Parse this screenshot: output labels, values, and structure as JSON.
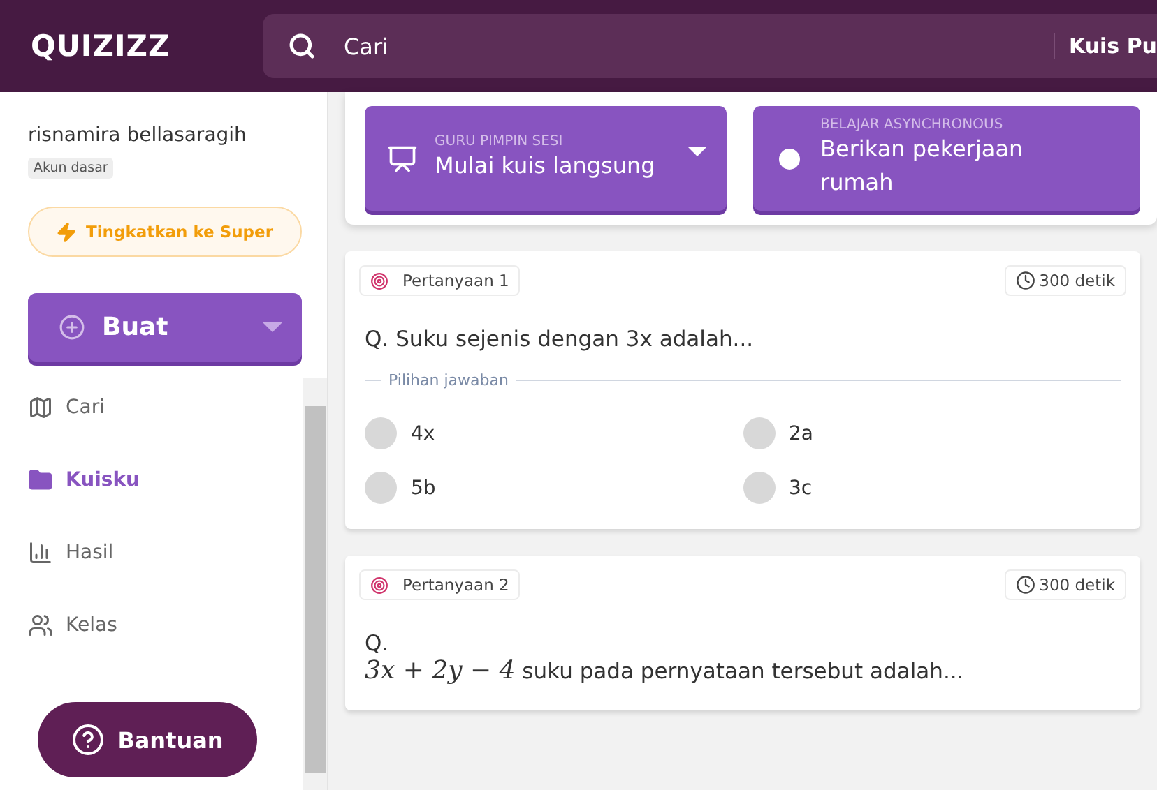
{
  "topbar": {
    "logo": "QUIZIZZ",
    "search": {
      "placeholder": "Cari"
    },
    "right_label": "Kuis Pu"
  },
  "user": {
    "name": "risnamira bellasaragih",
    "plan": "Akun dasar"
  },
  "upgrade_button": "Tingkatkan ke Super",
  "create_button": "Buat",
  "nav": [
    {
      "kind": "map",
      "label": "Cari",
      "selected": false
    },
    {
      "kind": "folder",
      "label": "Kuisku",
      "selected": true
    },
    {
      "kind": "chart",
      "label": "Hasil",
      "selected": false
    },
    {
      "kind": "class",
      "label": "Kelas",
      "selected": false
    }
  ],
  "help_button": "Bantuan",
  "actions": [
    {
      "kind": "live",
      "caption": "GURU PIMPIN SESI",
      "label": "Mulai kuis langsung"
    },
    {
      "kind": "homework",
      "caption": "BELAJAR ASYNCHRONOUS",
      "label": "Berikan pekerjaan rumah"
    }
  ],
  "questions": [
    {
      "title": "Pertanyaan 1",
      "time": "300 detik",
      "prefix": "Q.",
      "text": "Suku sejenis dengan 3x adalah...",
      "choices_label": "Pilihan jawaban",
      "choices": [
        "4x",
        "2a",
        "5b",
        "3c"
      ]
    },
    {
      "title": "Pertanyaan 2",
      "time": "300 detik",
      "prefix": "Q.",
      "math": "3x + 2y − 4",
      "text": "suku pada pernyataan tersebut adalah..."
    }
  ]
}
